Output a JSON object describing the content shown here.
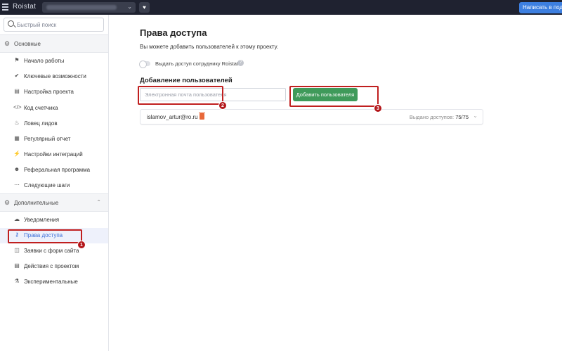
{
  "topbar": {
    "logo": "Roistat",
    "project_select_icon": "chevron-down-icon",
    "heart_icon": "heart-icon",
    "write_button": "Написать в подд"
  },
  "sidebar": {
    "search_placeholder": "Быстрый поиск",
    "section_main": {
      "label": "Основные",
      "icon": "gear-icon"
    },
    "main_items": [
      {
        "label": "Начало работы",
        "icon": "flag-icon"
      },
      {
        "label": "Ключевые возможности",
        "icon": "check-circle-icon"
      },
      {
        "label": "Настройка проекта",
        "icon": "clipboard-icon"
      },
      {
        "label": "Код счетчика",
        "icon": "code-icon"
      },
      {
        "label": "Ловец лидов",
        "icon": "bell-icon"
      },
      {
        "label": "Регулярный отчет",
        "icon": "calendar-icon"
      },
      {
        "label": "Настройки интеграций",
        "icon": "plug-icon"
      },
      {
        "label": "Реферальная программа",
        "icon": "users-icon"
      },
      {
        "label": "Следующие шаги",
        "icon": "dots-icon"
      }
    ],
    "section_extra": {
      "label": "Дополнительные",
      "icon": "gears-icon"
    },
    "extra_items": [
      {
        "label": "Уведомления",
        "icon": "cloud-icon"
      },
      {
        "label": "Права доступа",
        "icon": "key-icon",
        "active": true
      },
      {
        "label": "Заявки с форм сайта",
        "icon": "cart-icon"
      },
      {
        "label": "Действия с проектом",
        "icon": "list-icon"
      },
      {
        "label": "Экспериментальные",
        "icon": "flask-icon"
      }
    ]
  },
  "main": {
    "title": "Права доступа",
    "description": "Вы можете добавить пользователей к этому проекту.",
    "toggle_label": "Выдать доступ сотруднику Roistat",
    "toggle_on": false,
    "add_title": "Добавление пользователей",
    "email_placeholder": "Электронная почта пользователя",
    "add_button": "Добавить пользователя",
    "users": [
      {
        "email": "islamov_artur@ro.ru",
        "access_label": "Выдано доступов:",
        "access_value": "75/75"
      }
    ]
  },
  "annotations": [
    {
      "number": "1"
    },
    {
      "number": "2"
    },
    {
      "number": "3"
    }
  ]
}
